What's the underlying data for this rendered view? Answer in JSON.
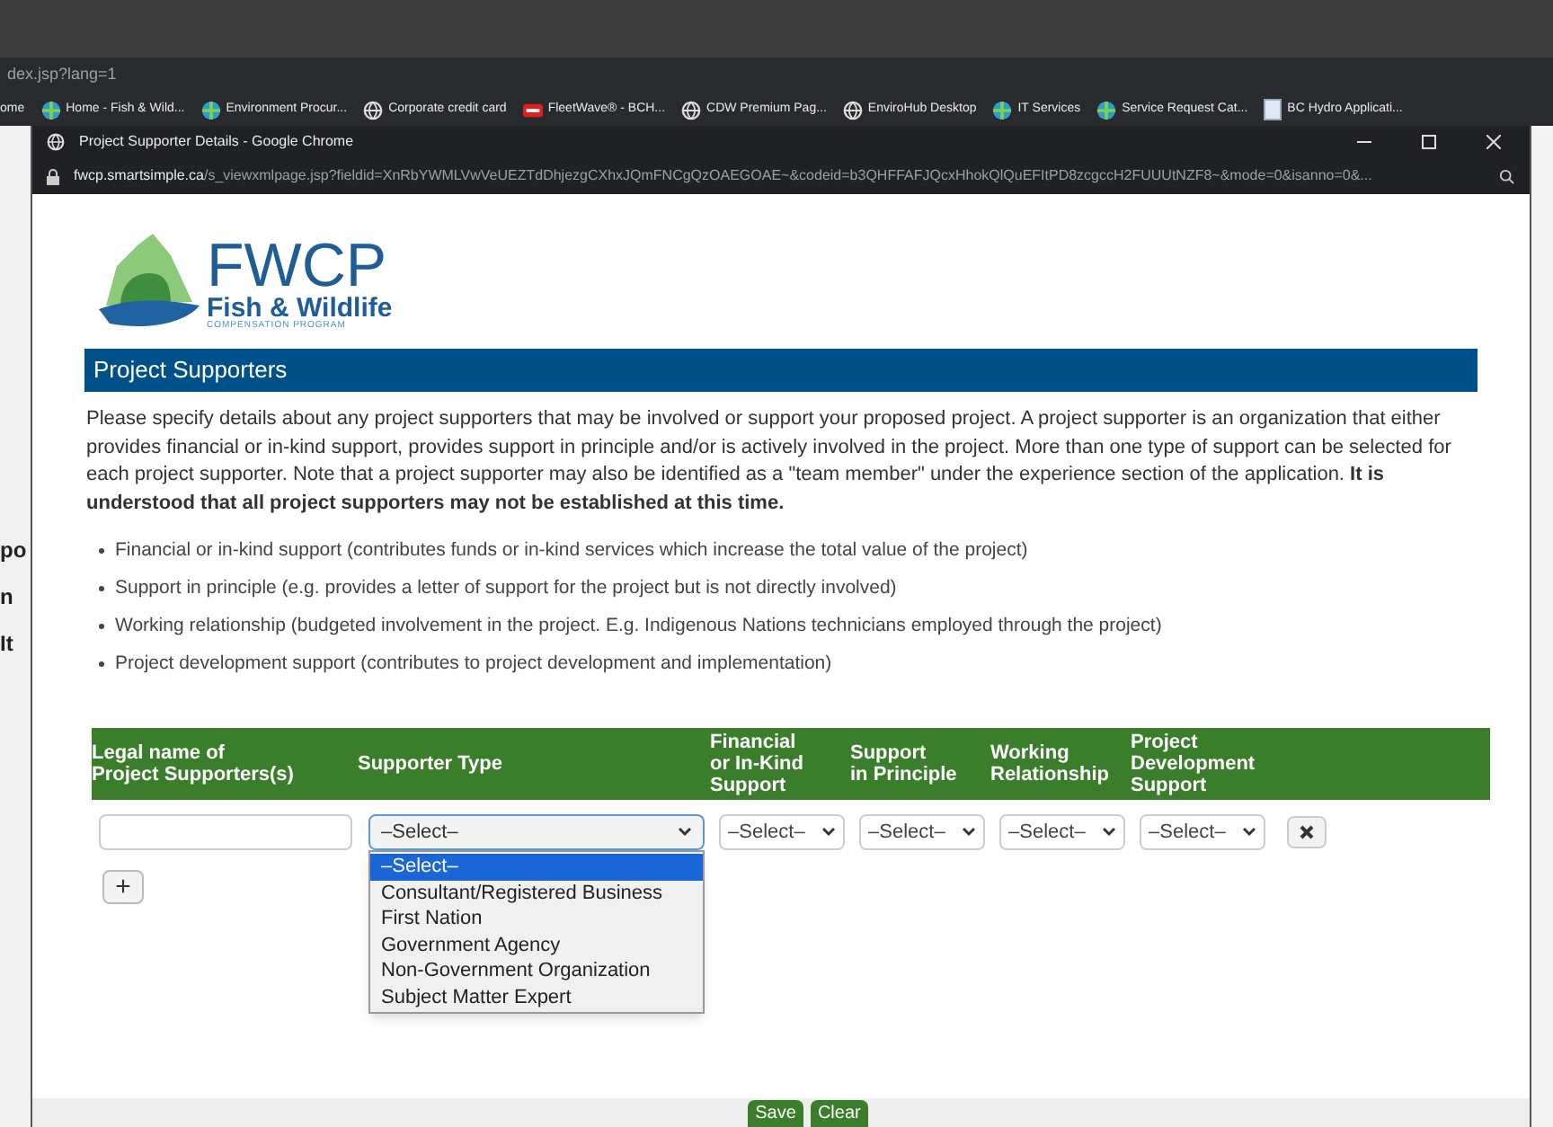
{
  "browser": {
    "address": "dex.jsp?lang=1",
    "bookmarks": [
      {
        "label": "ome",
        "kind": "plain"
      },
      {
        "label": "Home - Fish & Wild...",
        "kind": "colorful"
      },
      {
        "label": "Environment Procur...",
        "kind": "colorful"
      },
      {
        "label": "Corporate credit card",
        "kind": "web"
      },
      {
        "label": "FleetWave® - BCH...",
        "kind": "sign"
      },
      {
        "label": "CDW Premium Pag...",
        "kind": "web"
      },
      {
        "label": "EnviroHub Desktop",
        "kind": "web"
      },
      {
        "label": "IT Services",
        "kind": "colorful"
      },
      {
        "label": "Service Request Cat...",
        "kind": "colorful"
      },
      {
        "label": "BC Hydro Applicati...",
        "kind": "page"
      }
    ]
  },
  "background_fragments": [
    "po",
    "n",
    "It"
  ],
  "popup": {
    "title": "Project Supporter Details - Google Chrome",
    "url_host": "fwcp.smartsimple.ca",
    "url_path": "/s_viewxmlpage.jsp?fieldid=XnRbYWMLVwVeUEZTdDhjezgCXhxJQmFNCgQzOAEGOAE~&codeid=b3QHFFAFJQcxHhokQlQuEFItPD8zcgccH2FUUUtNZF8~&mode=0&isanno=0&..."
  },
  "logo": {
    "title": "FWCP",
    "subtitle": "Fish & Wildlife",
    "tagline": "COMPENSATION PROGRAM"
  },
  "section_title": "Project Supporters",
  "intro": "Please specify details about any project supporters that may be involved or support your proposed project. A project supporter is an organization that either provides financial or in-kind support, provides support in principle and/or is actively involved in the project. More than one type of support can be selected for each project supporter. Note that a project supporter may also be identified as a \"team member\" under the experience section of the application. **It is understood that all project supporters may not be established at this time.**",
  "bullets": [
    "Financial or in-kind support (contributes funds or in-kind services which increase the total value of the project)",
    "Support in principle (e.g. provides a letter of support for the project but is not directly involved)",
    "Working relationship (budgeted involvement in the project. E.g. Indigenous Nations technicians employed through the project)",
    "Project development support (contributes to project development and implementation)"
  ],
  "table": {
    "columns": [
      "Legal name of\nProject Supporters(s)",
      "Supporter Type",
      "Financial\nor In-Kind\nSupport",
      "Support\nin Principle",
      "Working\nRelationship",
      "Project\nDevelopment\nSupport"
    ],
    "row": {
      "supporter_type": {
        "value": "–Select–",
        "expanded": true,
        "options": [
          {
            "label": "–Select–",
            "selected": true
          },
          {
            "label": "Consultant/Registered Business",
            "selected": false
          },
          {
            "label": "First Nation",
            "selected": false
          },
          {
            "label": "Government Agency",
            "selected": false
          },
          {
            "label": "Non-Government Organization",
            "selected": false
          },
          {
            "label": "Subject Matter Expert",
            "selected": false
          }
        ]
      },
      "selects": [
        "–Select–",
        "–Select–",
        "–Select–",
        "–Select–"
      ]
    },
    "add_button": "+"
  },
  "buttons": [
    "Save",
    "Clear"
  ]
}
